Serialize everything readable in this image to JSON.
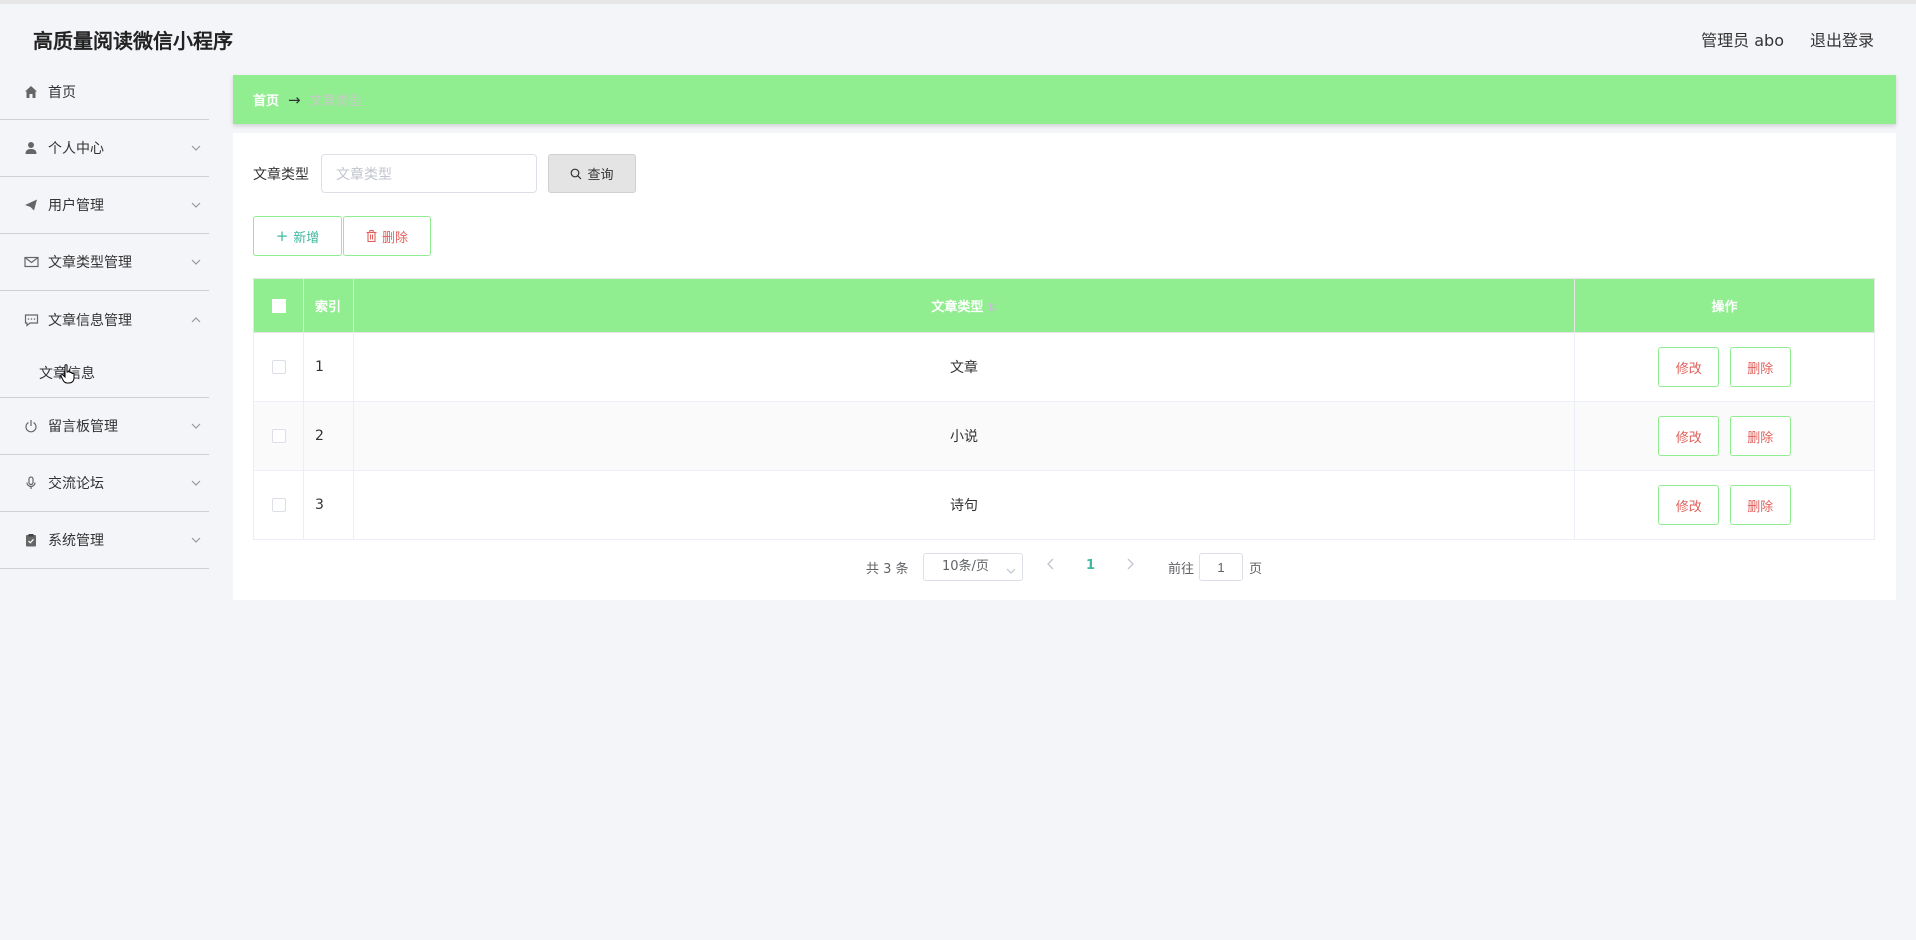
{
  "header": {
    "app_title": "高质量阅读微信小程序",
    "admin_label": "管理员 abo",
    "logout_label": "退出登录"
  },
  "sidebar": {
    "items": [
      {
        "label": "首页",
        "icon": "home-icon"
      },
      {
        "label": "个人中心",
        "icon": "user-icon"
      },
      {
        "label": "用户管理",
        "icon": "send-icon"
      },
      {
        "label": "文章类型管理",
        "icon": "mail-icon"
      },
      {
        "label": "文章信息管理",
        "icon": "chat-icon",
        "expanded": true,
        "children": [
          {
            "label": "文章信息"
          }
        ]
      },
      {
        "label": "留言板管理",
        "icon": "power-icon"
      },
      {
        "label": "交流论坛",
        "icon": "microphone-icon"
      },
      {
        "label": "系统管理",
        "icon": "clipboard-icon"
      }
    ]
  },
  "breadcrumb": {
    "home": "首页",
    "arrow": "→",
    "current": "文章类型"
  },
  "search": {
    "label": "文章类型",
    "placeholder": "文章类型",
    "button": "查询"
  },
  "actions": {
    "add": "新增",
    "delete": "删除"
  },
  "table": {
    "headers": {
      "index": "索引",
      "type": "文章类型",
      "ops": "操作"
    },
    "rows": [
      {
        "index": "1",
        "type": "文章",
        "edit": "修改",
        "delete": "删除"
      },
      {
        "index": "2",
        "type": "小说",
        "edit": "修改",
        "delete": "删除"
      },
      {
        "index": "3",
        "type": "诗句",
        "edit": "修改",
        "delete": "删除"
      }
    ]
  },
  "pagination": {
    "total": "共 3 条",
    "page_size": "10条/页",
    "current_page": "1",
    "goto_label": "前往",
    "goto_value": "1",
    "page_suffix": "页"
  },
  "colors": {
    "accent_green": "#90ee90",
    "link_teal": "#41b8a0",
    "danger_red": "#e0605c"
  }
}
